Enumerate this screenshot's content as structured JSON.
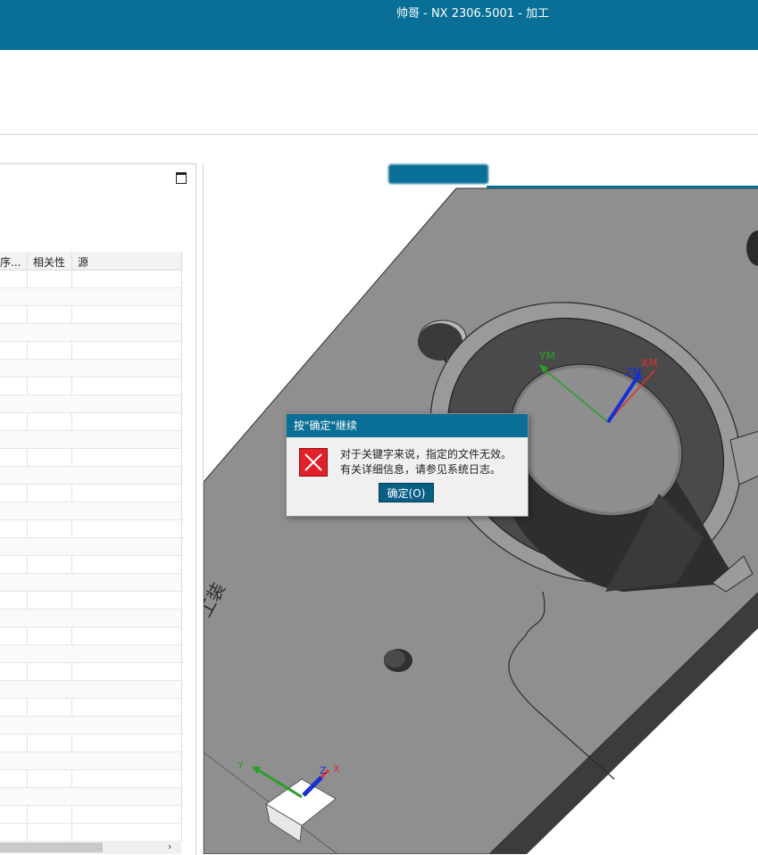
{
  "window": {
    "title": "帅哥 - NX 2306.5001 - 加工"
  },
  "navigator": {
    "columns": [
      "序...",
      "相关性",
      "源"
    ],
    "row_count": 31,
    "scroll_right_icon": "chevron-right-icon"
  },
  "viewport": {
    "part_label": "工装",
    "wcs_labels": {
      "ym": "YM",
      "zm": "ZM",
      "xm": "XM"
    },
    "triad_labels": {
      "x": "X",
      "y": "Y",
      "z": "Z"
    }
  },
  "dialog": {
    "title": "按\"确定\"继续",
    "icon": "error-icon",
    "message_line1": "对于关键字来说，指定的文件无效。",
    "message_line2": "有关详细信息，请参见系统日志。",
    "ok_label": "确定(O)"
  },
  "colors": {
    "titlebar": "#0a6f96",
    "part_face": "#8c8c8c",
    "error_red": "#e0202a",
    "axis_x": "#e03030",
    "axis_y": "#2aa02a",
    "axis_z": "#1a2fd0"
  }
}
